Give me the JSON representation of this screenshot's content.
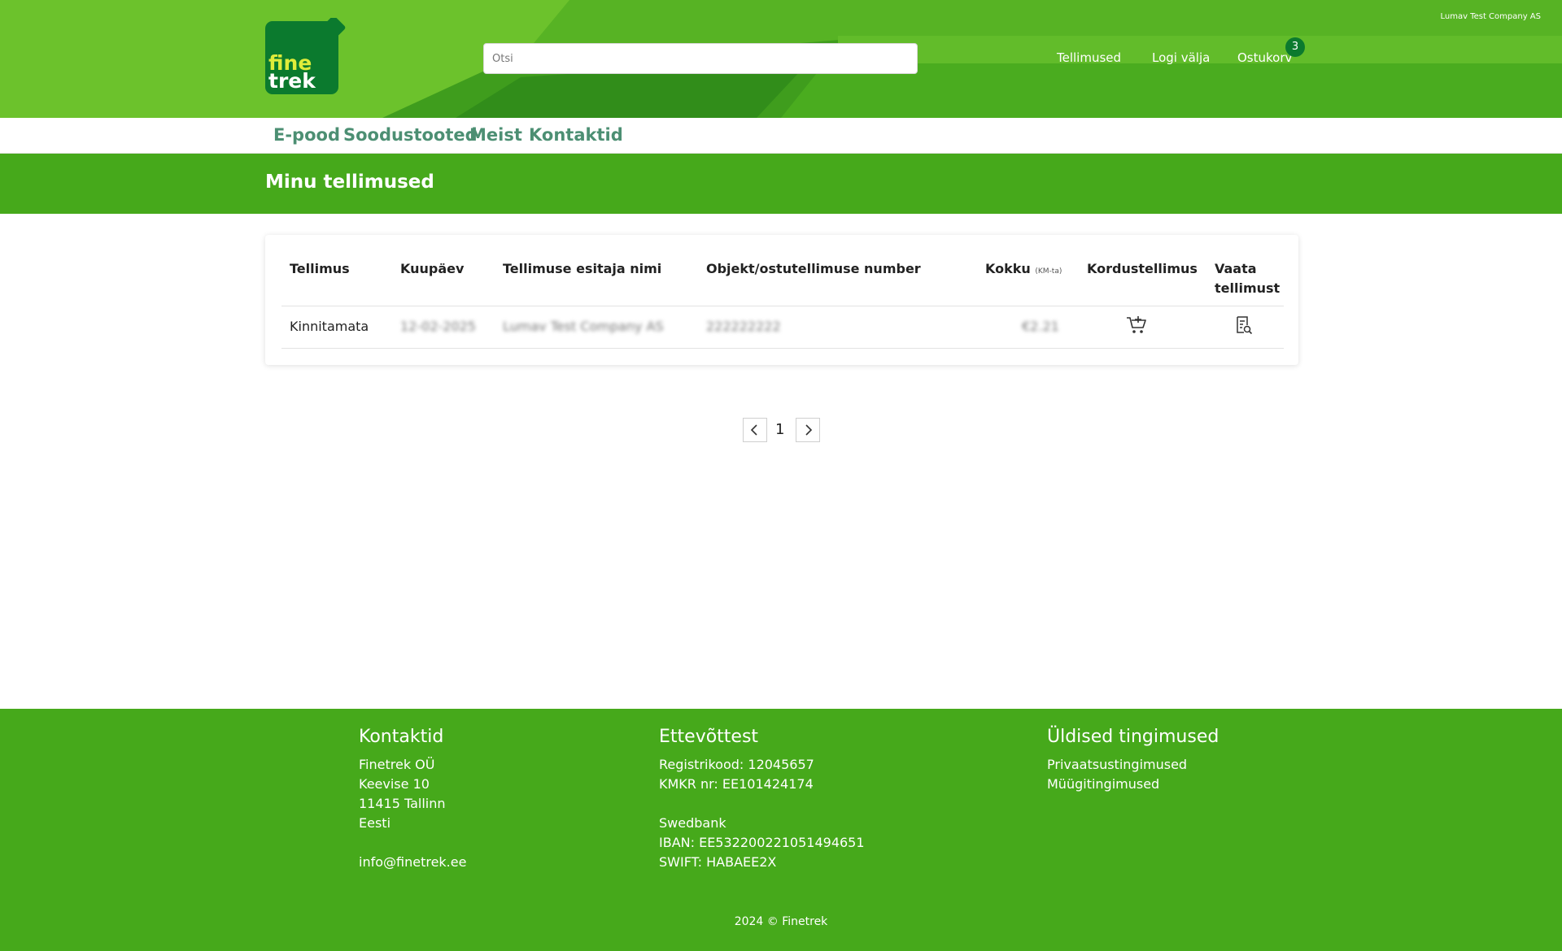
{
  "header": {
    "company_name": "Lumav Test Company AS",
    "logo_text_top": "fine",
    "logo_text_bottom": "trek",
    "search": {
      "placeholder": "Otsi",
      "value": ""
    },
    "links": {
      "orders": "Tellimused",
      "logout": "Logi välja",
      "cart": "Ostukorv"
    },
    "cart_count": "3",
    "colors": {
      "header_green": "#57b324",
      "logo_green": "#0b7a2e",
      "logo_yellow": "#e0ec3a"
    }
  },
  "nav": {
    "items": [
      {
        "label": "E-pood"
      },
      {
        "label": "Soodustooted"
      },
      {
        "label": "Meist"
      },
      {
        "label": "Kontaktid"
      }
    ]
  },
  "page": {
    "title": "Minu tellimused"
  },
  "orders": {
    "columns": {
      "order": "Tellimus",
      "date": "Kuupäev",
      "submitter": "Tellimuse esitaja nimi",
      "object": "Objekt/ostutellimuse number",
      "total": "Kokku",
      "total_note": "(KM-ta)",
      "reorder": "Kordustellimus",
      "view_line1": "Vaata",
      "view_line2": "tellimust"
    },
    "rows": [
      {
        "status": "Kinnitamata",
        "date": "12-02-2025",
        "submitter": "Lumav Test Company AS",
        "object": "222222222",
        "total": "€2.21",
        "reorder_icon": "cart-plus-icon",
        "view_icon": "document-search-icon"
      }
    ]
  },
  "pagination": {
    "current_page": "1",
    "prev_icon": "chevron-left-icon",
    "next_icon": "chevron-right-icon"
  },
  "footer": {
    "contacts": {
      "heading": "Kontaktid",
      "company": "Finetrek OÜ",
      "street": "Keevise 10",
      "city": "11415 Tallinn",
      "country": "Eesti",
      "email": "info@finetrek.ee"
    },
    "company": {
      "heading": "Ettevõttest",
      "reg_code": "Registrikood: 12045657",
      "vat": "KMKR nr: EE101424174",
      "bank": "Swedbank",
      "iban": "IBAN: EE532200221051494651",
      "swift": "SWIFT: HABAEE2X"
    },
    "terms": {
      "heading": "Üldised tingimused",
      "privacy": "Privaatsustingimused",
      "sales": "Müügitingimused"
    },
    "copyright": "2024 © Finetrek"
  }
}
